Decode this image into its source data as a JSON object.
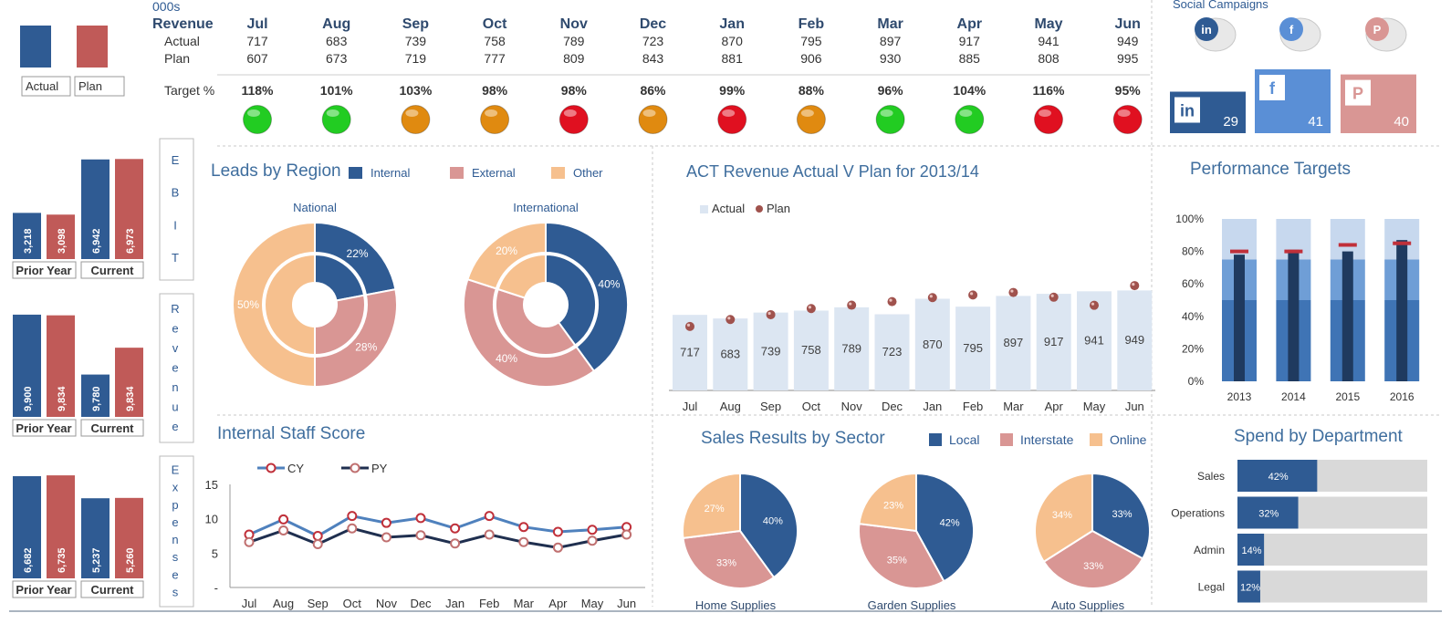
{
  "units_label": "000s",
  "legend_left": {
    "actual": "Actual",
    "plan": "Plan"
  },
  "summary": {
    "revenue_label": "Revenue",
    "actual_label": "Actual",
    "plan_label": "Plan",
    "target_label": "Target %",
    "months": [
      "Jul",
      "Aug",
      "Sep",
      "Oct",
      "Nov",
      "Dec",
      "Jan",
      "Feb",
      "Mar",
      "Apr",
      "May",
      "Jun"
    ],
    "actual": [
      717,
      683,
      739,
      758,
      789,
      723,
      870,
      795,
      897,
      917,
      941,
      949
    ],
    "plan": [
      607,
      673,
      719,
      777,
      809,
      843,
      881,
      906,
      930,
      885,
      808,
      995
    ],
    "target_pct": [
      "118%",
      "101%",
      "103%",
      "98%",
      "98%",
      "86%",
      "99%",
      "88%",
      "96%",
      "104%",
      "116%",
      "95%"
    ],
    "status": [
      "green",
      "green",
      "amber",
      "amber",
      "red",
      "amber",
      "red",
      "amber",
      "green",
      "green",
      "red",
      "red"
    ]
  },
  "colors": {
    "blue": "#2f5b93",
    "red": "#c05a58",
    "peach": "#f6c08e",
    "pink": "#d99694",
    "light_blue": "#dce6f2",
    "green": "#22cc22",
    "amber": "#e08a10",
    "status_red": "#e01020"
  },
  "kpi_groups": [
    {
      "side_label": "EBIT",
      "values": [
        "3,218",
        "3,098",
        "6,942",
        "6,973"
      ],
      "nums": [
        3218,
        3098,
        6942,
        6973
      ],
      "max": 7500,
      "prior_label": "Prior Year",
      "current_label": "Current"
    },
    {
      "side_label": "Revenue",
      "values": [
        "9,900",
        "9,834",
        "9,780",
        "9,834"
      ],
      "nums": [
        9900,
        9834,
        4100,
        6700
      ],
      "max": 10600,
      "prior_label": "Prior Year",
      "current_label": "Current"
    },
    {
      "side_label": "Expenses",
      "values": [
        "6,682",
        "6,735",
        "5,237",
        "5,260"
      ],
      "nums": [
        6682,
        6735,
        5237,
        5260
      ],
      "max": 6800,
      "prior_label": "Prior Year",
      "current_label": "Current"
    }
  ],
  "social": {
    "title": "Social Campaigns",
    "items": [
      {
        "name": "linkedin",
        "glyph": "in",
        "count": "29",
        "color": "#2f5b93",
        "level": 0.65
      },
      {
        "name": "facebook",
        "glyph": "f",
        "count": "41",
        "color": "#5a8fd6",
        "level": 1.0
      },
      {
        "name": "pinterest",
        "glyph": "P",
        "count": "40",
        "color": "#d99694",
        "level": 0.92
      }
    ]
  },
  "leads": {
    "title": "Leads by Region",
    "legend": [
      "Internal",
      "External",
      "Other"
    ],
    "charts": [
      {
        "title": "National",
        "values": [
          22,
          28,
          50
        ],
        "labels": [
          "22%",
          "28%",
          "50%"
        ]
      },
      {
        "title": "International",
        "values": [
          40,
          40,
          20
        ],
        "labels": [
          "40%",
          "40%",
          "20%"
        ]
      }
    ]
  },
  "chart_data": [
    {
      "type": "bar",
      "title": "ACT Revenue Actual V Plan for 2013/14",
      "legend": [
        "Actual",
        "Plan"
      ],
      "categories": [
        "Jul",
        "Aug",
        "Sep",
        "Oct",
        "Nov",
        "Dec",
        "Jan",
        "Feb",
        "Mar",
        "Apr",
        "May",
        "Jun"
      ],
      "series": [
        {
          "name": "Actual",
          "values": [
            717,
            683,
            739,
            758,
            789,
            723,
            870,
            795,
            897,
            917,
            941,
            949
          ]
        },
        {
          "name": "Plan",
          "values": [
            607,
            673,
            719,
            777,
            809,
            843,
            881,
            906,
            930,
            885,
            808,
            995
          ]
        }
      ],
      "ylim": [
        0,
        1050
      ]
    },
    {
      "type": "bar",
      "title": "Performance Targets",
      "categories": [
        "2013",
        "2014",
        "2015",
        "2016"
      ],
      "yticks": [
        "100%",
        "80%",
        "60%",
        "40%",
        "20%",
        "0%"
      ],
      "ylim": [
        0,
        100
      ],
      "bands": [
        50,
        75,
        100
      ],
      "actual": [
        78,
        81,
        80,
        87
      ],
      "target": [
        80,
        80,
        84,
        85
      ]
    },
    {
      "type": "line",
      "title": "Internal Staff Score",
      "categories": [
        "Jul",
        "Aug",
        "Sep",
        "Oct",
        "Nov",
        "Dec",
        "Jan",
        "Feb",
        "Mar",
        "Apr",
        "May",
        "Jun"
      ],
      "yticks": [
        "15",
        "10",
        "5",
        "-"
      ],
      "ylim": [
        0,
        15
      ],
      "series": [
        {
          "name": "CY",
          "values": [
            7.7,
            9.9,
            7.5,
            10.4,
            9.4,
            10.1,
            8.6,
            10.4,
            8.8,
            8.1,
            8.4,
            8.8
          ]
        },
        {
          "name": "PY",
          "values": [
            6.6,
            8.3,
            6.3,
            8.6,
            7.3,
            7.6,
            6.4,
            7.7,
            6.6,
            5.8,
            6.8,
            7.7
          ]
        }
      ]
    },
    {
      "type": "pie",
      "title": "Sales Results by Sector",
      "legend": [
        "Local",
        "Interstate",
        "Online"
      ],
      "charts": [
        {
          "name": "Home Supplies",
          "values": [
            40,
            33,
            27
          ],
          "labels": [
            "40%",
            "33%",
            "27%"
          ]
        },
        {
          "name": "Garden Supplies",
          "values": [
            42,
            35,
            23
          ],
          "labels": [
            "42%",
            "35%",
            "23%"
          ]
        },
        {
          "name": "Auto Supplies",
          "values": [
            33,
            33,
            34
          ],
          "labels": [
            "33%",
            "33%",
            "34%"
          ]
        }
      ]
    },
    {
      "type": "bar",
      "title": "Spend by Department",
      "categories": [
        "Sales",
        "Operations",
        "Admin",
        "Legal"
      ],
      "values": [
        42,
        32,
        14,
        12
      ],
      "labels": [
        "42%",
        "32%",
        "14%",
        "12%"
      ]
    }
  ]
}
